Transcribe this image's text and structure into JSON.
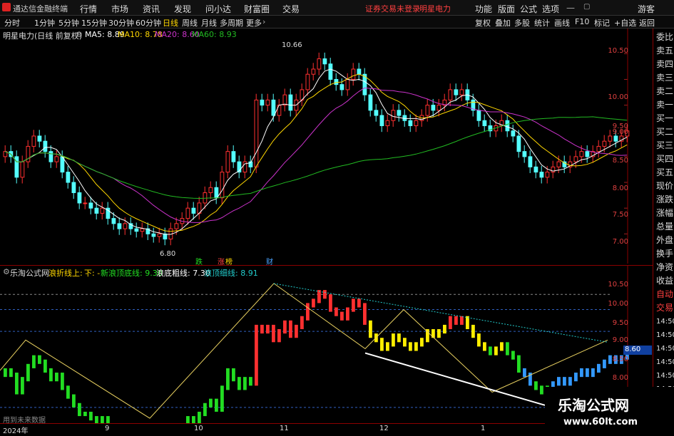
{
  "app": {
    "title": "通达信金融终端"
  },
  "menu": [
    "行情",
    "市场",
    "资讯",
    "发现",
    "问小达",
    "财富圈",
    "交易"
  ],
  "alerts": {
    "login": "证券交易未登录",
    "stock": "明星电力"
  },
  "menu_right": [
    "功能",
    "版面",
    "公式",
    "选项"
  ],
  "guest": "游客",
  "periods": [
    "分时",
    "1分钟",
    "5分钟",
    "15分钟",
    "30分钟",
    "60分钟",
    "日线",
    "周线",
    "月线",
    "多周期",
    "更多"
  ],
  "active_period": "日线",
  "tools": [
    "复权",
    "叠加",
    "多股",
    "统计",
    "画线",
    "F10",
    "标记",
    "+自选",
    "返回"
  ],
  "main": {
    "title": "明星电力(日线 前复权)",
    "ma": [
      {
        "label": "MA5: 8.89",
        "color": "#ffffff"
      },
      {
        "label": "MA10: 8.78",
        "color": "#ffd700"
      },
      {
        "label": "MA20: 8.60",
        "color": "#cc33cc"
      },
      {
        "label": "MA60: 8.93",
        "color": "#22bb22"
      }
    ],
    "high_label": "10.66",
    "low_label": "6.80",
    "events": [
      {
        "label": "跌",
        "color": "#22dd22"
      },
      {
        "label": "涨",
        "color": "#ff4040"
      },
      {
        "label": "榜",
        "color": "#ffd700"
      },
      {
        "label": "财",
        "color": "#4aa3ff"
      }
    ],
    "yticks": [
      "10.50",
      "10.00",
      "9.50",
      "9.00",
      "8.50",
      "8.00",
      "7.50",
      "7.00"
    ],
    "yvals": [
      10.5,
      10.0,
      9.5,
      9.0,
      8.5,
      8.0,
      7.5,
      7.0
    ]
  },
  "sub": {
    "title": "乐淘公式网",
    "legend": [
      {
        "label": "浪折线上: -",
        "color": "#ffd700"
      },
      {
        "label": "下: -",
        "color": "#ffd700"
      },
      {
        "label": "新浪顶底线: 9.30",
        "color": "#22dd22"
      },
      {
        "label": "浪底粗线: 7.30",
        "color": "#ffffff"
      },
      {
        "label": "浪顶细线: 8.91",
        "color": "#22cccc"
      }
    ],
    "yticks": [
      "10.50",
      "10.00",
      "9.50",
      "9.00",
      "8.50",
      "8.00"
    ],
    "current_price": "8.60",
    "no_data": "用到未来数据"
  },
  "right_panel": [
    "委比",
    "卖五",
    "卖四",
    "卖三",
    "卖二",
    "卖一",
    "买一",
    "买二",
    "买三",
    "买四",
    "买五",
    "现价",
    "涨跌",
    "涨幅",
    "总量",
    "外盘",
    "换手",
    "净资",
    "收益",
    "自动",
    "交易",
    "14:50",
    "14:50",
    "14:50",
    "14:50",
    "14:50",
    "14:50",
    "14:50",
    "14:50",
    "14:50"
  ],
  "dates": [
    "2024年",
    "9",
    "10",
    "11",
    "12",
    "1"
  ],
  "watermark": {
    "name": "乐淘公式网",
    "url": "www.60lt.com"
  },
  "chart_data": {
    "type": "candlestick",
    "ylim": [
      6.7,
      10.85
    ],
    "close": [
      8.6,
      8.5,
      8.1,
      8.4,
      8.7,
      8.9,
      8.8,
      8.6,
      8.4,
      8.5,
      8.2,
      8.0,
      7.8,
      7.6,
      7.6,
      7.5,
      7.4,
      7.5,
      7.3,
      7.2,
      7.1,
      7.2,
      7.1,
      7.05,
      7.1,
      7.0,
      6.95,
      7.0,
      6.9,
      7.1,
      7.2,
      7.3,
      7.5,
      7.4,
      7.6,
      7.8,
      7.9,
      7.7,
      8.2,
      8.6,
      8.4,
      8.2,
      8.4,
      8.3,
      9.6,
      9.5,
      9.6,
      9.3,
      9.5,
      9.7,
      9.4,
      9.6,
      9.8,
      10.1,
      10.2,
      10.4,
      10.3,
      10.0,
      9.9,
      9.8,
      10.0,
      10.2,
      10.1,
      9.7,
      9.4,
      9.3,
      9.1,
      9.2,
      9.4,
      9.3,
      9.2,
      9.1,
      9.2,
      9.3,
      9.5,
      9.4,
      9.5,
      9.6,
      9.8,
      9.7,
      9.8,
      9.6,
      9.4,
      9.2,
      9.1,
      9.0,
      9.1,
      9.2,
      9.0,
      8.9,
      8.6,
      8.5,
      8.3,
      8.2,
      8.1,
      8.2,
      8.3,
      8.4,
      8.3,
      8.4,
      8.5,
      8.6,
      8.5,
      8.6,
      8.7,
      8.8,
      8.9,
      8.8,
      8.9,
      9.0
    ]
  }
}
